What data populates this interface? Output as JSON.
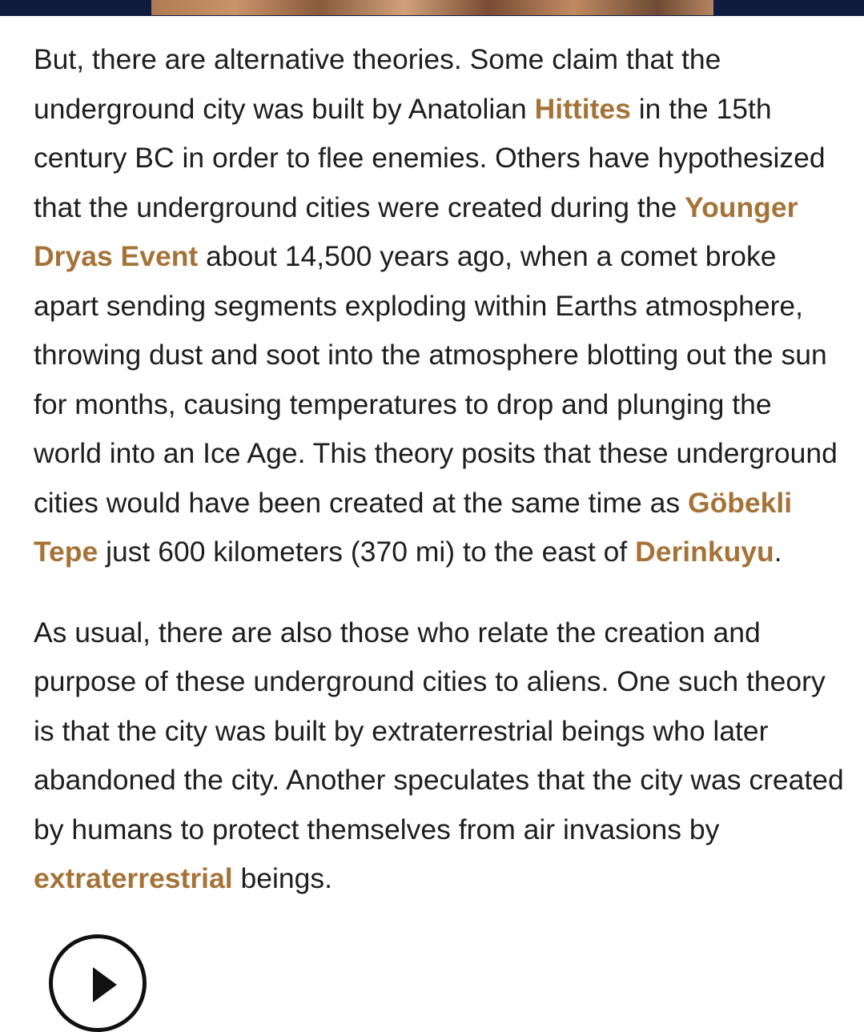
{
  "article": {
    "paragraph1": {
      "t1": "But, there are alternative theories. Some claim that the underground city was built by Anatolian ",
      "link_hittites": "Hittites",
      "t2": " in the 15th century BC in order to flee enemies. Others have hypothesized that the underground cities were created during the ",
      "link_younger_dryas": "Younger Dryas Event",
      "t3": " about 14,500 years ago, when a comet broke apart sending segments exploding within Earths atmosphere, throwing dust and soot into the atmosphere blotting out the sun for months, causing temperatures to drop and plunging the world into an Ice Age. This theory posits that these underground cities would have been created at the same time as ",
      "link_gobekli_tepe": "Göbekli Tepe",
      "t4": " just 600 kilometers (370 mi) to the east of ",
      "link_derinkuyu": "Derinkuyu",
      "t5": "."
    },
    "paragraph2": {
      "t1": "As usual, there are also those who relate the creation and purpose of these underground cities to aliens. One such theory is that the city was built by extraterrestrial beings who later abandoned the city. Another speculates that the city was created by humans to protect themselves from air invasions by ",
      "link_extraterrestrial": "extraterrestrial",
      "t2": " beings."
    }
  },
  "colors": {
    "link": "#a57337",
    "text": "#1e1e1e",
    "header_band": "#0f1c3f"
  },
  "icons": {
    "media_control": "play-icon"
  }
}
